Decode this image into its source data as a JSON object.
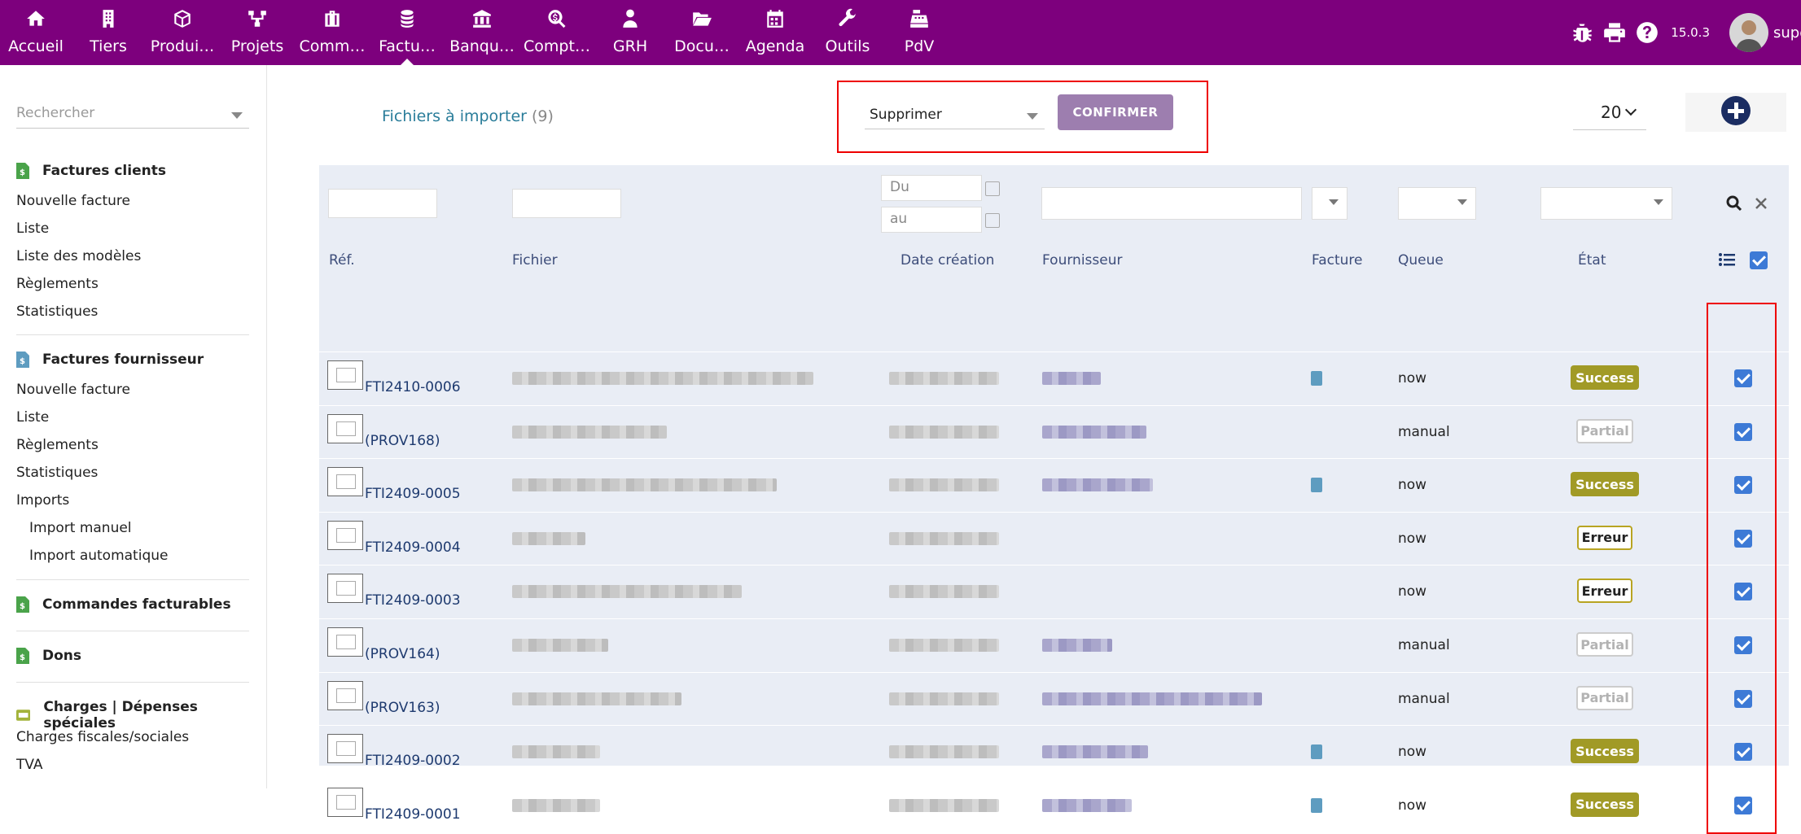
{
  "topnav": {
    "items": [
      {
        "label": "Accueil",
        "icon": "home-icon"
      },
      {
        "label": "Tiers",
        "icon": "building-icon"
      },
      {
        "label": "Produi…",
        "icon": "cube-icon"
      },
      {
        "label": "Projets",
        "icon": "sitemap-icon"
      },
      {
        "label": "Comm…",
        "icon": "briefcase-icon"
      },
      {
        "label": "Factu…",
        "icon": "coins-icon"
      },
      {
        "label": "Banqu…",
        "icon": "bank-icon"
      },
      {
        "label": "Compt…",
        "icon": "search-dollar-icon"
      },
      {
        "label": "GRH",
        "icon": "user-tie-icon"
      },
      {
        "label": "Docu…",
        "icon": "folder-open-icon"
      },
      {
        "label": "Agenda",
        "icon": "calendar-icon"
      },
      {
        "label": "Outils",
        "icon": "wrench-icon"
      },
      {
        "label": "PdV",
        "icon": "cash-register-icon"
      }
    ],
    "active_index": 5,
    "version": "15.0.3",
    "username": "supe"
  },
  "sidebar": {
    "search_placeholder": "Rechercher",
    "sections": [
      {
        "title": "Factures clients",
        "items": [
          "Nouvelle facture",
          "Liste",
          "Liste des modèles",
          "Règlements",
          "Statistiques"
        ]
      },
      {
        "title": "Factures fournisseur",
        "items": [
          "Nouvelle facture",
          "Liste",
          "Règlements",
          "Statistiques",
          "Imports"
        ],
        "subitems": [
          "Import manuel",
          "Import automatique"
        ]
      },
      {
        "title": "Commandes facturables",
        "items": []
      },
      {
        "title": "Dons",
        "items": []
      },
      {
        "title": "Charges | Dépenses spéciales",
        "items": [
          "Charges fiscales/sociales",
          "TVA"
        ]
      }
    ]
  },
  "toolbar": {
    "title": "Fichiers à importer",
    "count": "(9)",
    "mass_action_value": "Supprimer",
    "confirm_label": "CONFIRMER",
    "limit_value": "20"
  },
  "filters": {
    "date_from_placeholder": "Du",
    "date_to_placeholder": "au"
  },
  "table": {
    "headers": {
      "ref": "Réf.",
      "file": "Fichier",
      "date": "Date création",
      "supplier": "Fournisseur",
      "invoice": "Facture",
      "queue": "Queue",
      "state": "État"
    },
    "rows": [
      {
        "ref": "FTI2410-0006",
        "has_invoice": true,
        "queue": "now",
        "state": "Success",
        "selected": true
      },
      {
        "ref": "(PROV168)",
        "has_invoice": false,
        "queue": "manual",
        "state": "Partial",
        "selected": true
      },
      {
        "ref": "FTI2409-0005",
        "has_invoice": true,
        "queue": "now",
        "state": "Success",
        "selected": true
      },
      {
        "ref": "FTI2409-0004",
        "has_invoice": false,
        "queue": "now",
        "state": "Erreur",
        "selected": true
      },
      {
        "ref": "FTI2409-0003",
        "has_invoice": false,
        "queue": "now",
        "state": "Erreur",
        "selected": true
      },
      {
        "ref": "(PROV164)",
        "has_invoice": false,
        "queue": "manual",
        "state": "Partial",
        "selected": true
      },
      {
        "ref": "(PROV163)",
        "has_invoice": false,
        "queue": "manual",
        "state": "Partial",
        "selected": true
      },
      {
        "ref": "FTI2409-0002",
        "has_invoice": true,
        "queue": "now",
        "state": "Success",
        "selected": true
      },
      {
        "ref": "FTI2409-0001",
        "has_invoice": true,
        "queue": "now",
        "state": "Success",
        "selected": true
      }
    ]
  },
  "colors": {
    "topbar": "#7d007d",
    "confirm": "#9d7eaf",
    "success": "#a19a26",
    "checkbox": "#3d7ad6",
    "highlight": "#ee0000"
  }
}
